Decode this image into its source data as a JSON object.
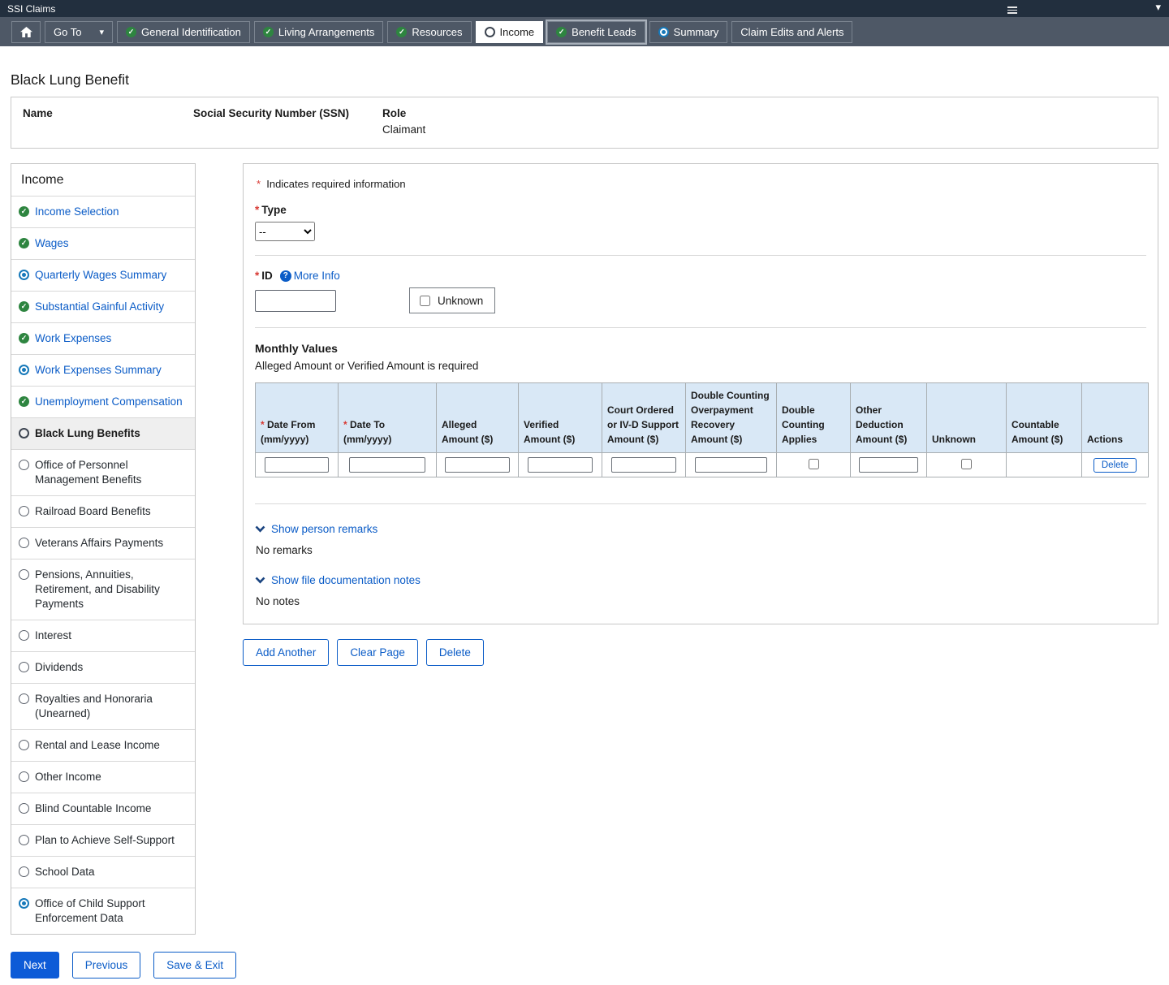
{
  "app": {
    "title": "SSI Claims"
  },
  "nav": {
    "go_to_label": "Go To",
    "tabs": [
      {
        "label": "General Identification",
        "status": "complete",
        "focused": false
      },
      {
        "label": "Living Arrangements",
        "status": "complete",
        "focused": false
      },
      {
        "label": "Resources",
        "status": "complete",
        "focused": false
      },
      {
        "label": "Income",
        "status": "active",
        "focused": false
      },
      {
        "label": "Benefit Leads",
        "status": "complete",
        "focused": true
      },
      {
        "label": "Summary",
        "status": "inprogress",
        "focused": false
      },
      {
        "label": "Claim Edits and Alerts",
        "status": "none",
        "focused": false
      }
    ]
  },
  "page": {
    "title": "Black Lung Benefit"
  },
  "person": {
    "name_label": "Name",
    "name_value": "",
    "ssn_label": "Social Security Number (SSN)",
    "ssn_value": "",
    "role_label": "Role",
    "role_value": "Claimant"
  },
  "sidebar": {
    "title": "Income",
    "items": [
      {
        "label": "Income Selection",
        "status": "complete",
        "link": true
      },
      {
        "label": "Wages",
        "status": "complete",
        "link": true
      },
      {
        "label": "Quarterly Wages Summary",
        "status": "inprogress",
        "link": true
      },
      {
        "label": "Substantial Gainful Activity",
        "status": "complete",
        "link": true
      },
      {
        "label": "Work Expenses",
        "status": "complete",
        "link": true
      },
      {
        "label": "Work Expenses Summary",
        "status": "inprogress",
        "link": true
      },
      {
        "label": "Unemployment Compensation",
        "status": "complete",
        "link": true
      },
      {
        "label": "Black Lung Benefits",
        "status": "active",
        "link": false
      },
      {
        "label": "Office of Personnel Management Benefits",
        "status": "notstarted",
        "link": false
      },
      {
        "label": "Railroad Board Benefits",
        "status": "notstarted",
        "link": false
      },
      {
        "label": "Veterans Affairs Payments",
        "status": "notstarted",
        "link": false
      },
      {
        "label": "Pensions, Annuities, Retirement, and Disability Payments",
        "status": "notstarted",
        "link": false
      },
      {
        "label": "Interest",
        "status": "notstarted",
        "link": false
      },
      {
        "label": "Dividends",
        "status": "notstarted",
        "link": false
      },
      {
        "label": "Royalties and Honoraria (Unearned)",
        "status": "notstarted",
        "link": false
      },
      {
        "label": "Rental and Lease Income",
        "status": "notstarted",
        "link": false
      },
      {
        "label": "Other Income",
        "status": "notstarted",
        "link": false
      },
      {
        "label": "Blind Countable Income",
        "status": "notstarted",
        "link": false
      },
      {
        "label": "Plan to Achieve Self-Support",
        "status": "notstarted",
        "link": false
      },
      {
        "label": "School Data",
        "status": "notstarted",
        "link": false
      },
      {
        "label": "Office of Child Support Enforcement Data",
        "status": "inprogress",
        "link": false
      }
    ]
  },
  "form": {
    "required_note": "Indicates required information",
    "type_label": "Type",
    "type_value": "--",
    "id_label": "ID",
    "more_info_label": "More Info",
    "id_value": "",
    "unknown_label": "Unknown",
    "monthly_values": {
      "title": "Monthly Values",
      "subtitle": "Alleged Amount or Verified Amount is required",
      "delete_label": "Delete",
      "columns": [
        {
          "label": "Date From (mm/yyyy)",
          "required": true,
          "cell": "input"
        },
        {
          "label": "Date To (mm/yyyy)",
          "required": true,
          "cell": "input"
        },
        {
          "label": "Alleged Amount ($)",
          "required": false,
          "cell": "input"
        },
        {
          "label": "Verified Amount ($)",
          "required": false,
          "cell": "input"
        },
        {
          "label": "Court Ordered or IV-D Support Amount ($)",
          "required": false,
          "cell": "input"
        },
        {
          "label": "Double Counting Overpayment Recovery Amount ($)",
          "required": false,
          "cell": "input"
        },
        {
          "label": "Double Counting Applies",
          "required": false,
          "cell": "checkbox"
        },
        {
          "label": "Other Deduction Amount ($)",
          "required": false,
          "cell": "input"
        },
        {
          "label": "Unknown",
          "required": false,
          "cell": "checkbox"
        },
        {
          "label": "Countable Amount ($)",
          "required": false,
          "cell": "empty"
        },
        {
          "label": "Actions",
          "required": false,
          "cell": "delete"
        }
      ],
      "row_values": {
        "date_from": "",
        "date_to": "",
        "alleged": "",
        "verified": "",
        "court_ordered": "",
        "double_counting_recovery": "",
        "double_counting_applies": false,
        "other_deduction": "",
        "unknown": false,
        "countable": ""
      }
    },
    "remarks": {
      "toggle_label": "Show person remarks",
      "empty_text": "No remarks"
    },
    "notes": {
      "toggle_label": "Show file documentation notes",
      "empty_text": "No notes"
    },
    "actions": {
      "add_another": "Add Another",
      "clear_page": "Clear Page",
      "delete": "Delete"
    }
  },
  "footer": {
    "next": "Next",
    "previous": "Previous",
    "save_exit": "Save & Exit"
  },
  "icons": {
    "complete": "check-circle",
    "inprogress": "target-circle",
    "active": "open-circle",
    "notstarted": "empty-circle",
    "home": "house",
    "dropdown": "caret-down",
    "menu": "hamburger-menu",
    "more_info": "question-circle",
    "toggle": "chevron-down"
  },
  "colors": {
    "topbar_bg": "#222f3e",
    "navbar_bg": "#4e5866",
    "link_blue": "#0b5cc7",
    "primary_blue": "#0d5bd7",
    "success_green": "#2e8540",
    "progress_blue": "#1779ba",
    "required_red": "#d83933",
    "table_header_bg": "#d9e8f6",
    "active_item_bg": "#efefef"
  }
}
